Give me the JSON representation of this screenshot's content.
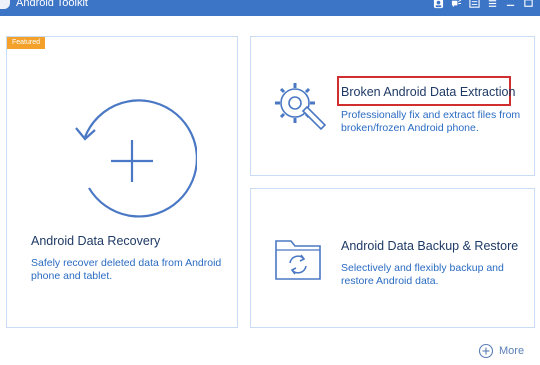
{
  "window": {
    "title": "Android Toolkit"
  },
  "cards": {
    "recovery": {
      "badge": "Featured",
      "title": "Android Data Recovery",
      "description": "Safely recover deleted data from Android phone and tablet."
    },
    "extraction": {
      "title": "Broken Android Data Extraction",
      "description": "Professionally fix and extract files from broken/frozen Android phone."
    },
    "backup": {
      "title": "Android Data Backup & Restore",
      "description": "Selectively and flexibly backup and restore Android data."
    }
  },
  "more": {
    "label": "More"
  },
  "colors": {
    "titlebar": "#3c74c6",
    "accent": "#4a78c4",
    "badge": "#f3a12a",
    "highlight": "#d12f2f"
  }
}
